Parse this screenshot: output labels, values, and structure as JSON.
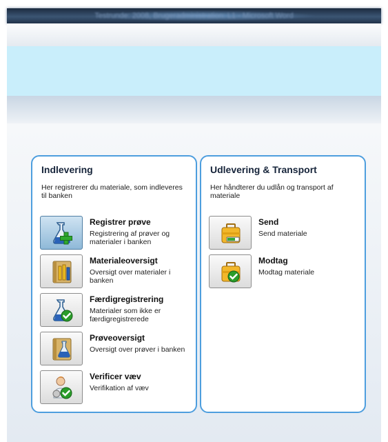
{
  "window": {
    "title": "Testrunde: 2008, Brugeradministration: L1 - Microsoft Word"
  },
  "panels": {
    "left": {
      "title": "Indlevering",
      "description": "Her registrerer du materiale, som indleveres til banken",
      "items": [
        {
          "label": "Registrer prøve",
          "description": "Registrering af prøver og materialer i banken",
          "icon": "flask-plus-icon",
          "active": true
        },
        {
          "label": "Materialeoversigt",
          "description": "Oversigt over materialer i banken",
          "icon": "binder-tubes-icon"
        },
        {
          "label": "Færdigregistrering",
          "description": "Materialer som ikke er færdigregistrerede",
          "icon": "flask-check-icon"
        },
        {
          "label": "Prøveoversigt",
          "description": "Oversigt over prøver i banken",
          "icon": "binder-flask-icon"
        },
        {
          "label": "Verificer væv",
          "description": "Verifikation af væv",
          "icon": "person-check-icon"
        }
      ]
    },
    "right": {
      "title": "Udlevering & Transport",
      "description": "Her håndterer du udlån og transport af materiale",
      "items": [
        {
          "label": "Send",
          "description": "Send materiale",
          "icon": "case-send-icon"
        },
        {
          "label": "Modtag",
          "description": "Modtag materiale",
          "icon": "case-check-icon"
        }
      ]
    }
  },
  "colors": {
    "panel_border": "#4d9ede",
    "band": "#c9eefb",
    "check": "#2a9d2a"
  }
}
